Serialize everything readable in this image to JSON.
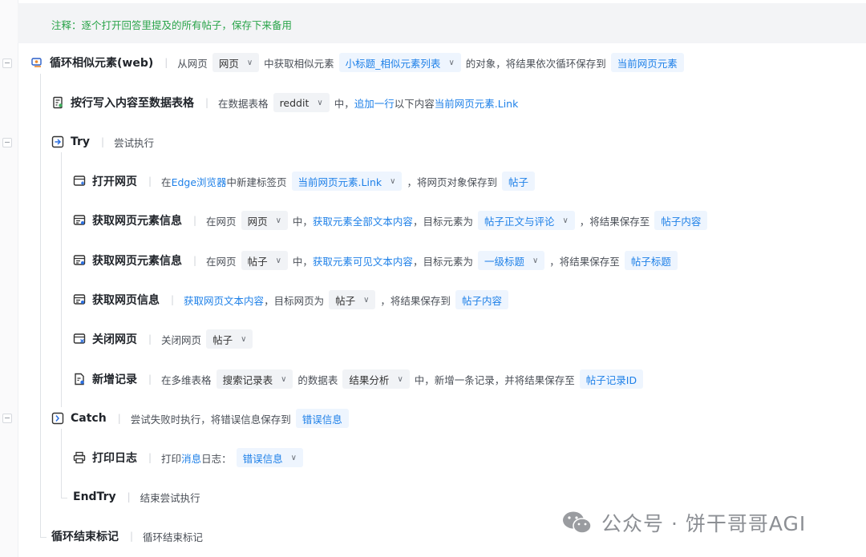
{
  "note": "注释：逐个打开回答里提及的所有帖子，保存下来备用",
  "loop": {
    "title": "循环相似元素(web)",
    "t1": "从网页",
    "chip1": "网页",
    "t2": "中获取相似元素",
    "chip2": "小标题_相似元素列表",
    "t3": "的对象，将结果依次循环保存到",
    "var": "当前网页元素"
  },
  "write": {
    "title": "按行写入内容至数据表格",
    "t1": "在数据表格",
    "chip1": "reddit",
    "t2": "中，",
    "lk1": "追加一行",
    "t3": "以下内容",
    "lk2": "当前网页元素.Link"
  },
  "try": {
    "title": "Try",
    "desc": "尝试执行"
  },
  "open": {
    "title": "打开网页",
    "t1": "在",
    "lk1": "Edge浏览器",
    "t2": "中新建标签页",
    "chip1": "当前网页元素.Link",
    "t3": "，将网页对象保存到",
    "var": "帖子"
  },
  "get1": {
    "title": "获取网页元素信息",
    "t1": "在网页",
    "chip1": "网页",
    "t2": "中，",
    "lk1": "获取元素全部文本内容",
    "t3": "，目标元素为",
    "chip2": "帖子正文与评论",
    "t4": "，将结果保存至",
    "var": "帖子内容"
  },
  "get2": {
    "title": "获取网页元素信息",
    "t1": "在网页",
    "chip1": "帖子",
    "t2": "中，",
    "lk1": "获取元素可见文本内容",
    "t3": "，目标元素为",
    "chip2": "一级标题",
    "t4": "，将结果保存至",
    "var": "帖子标题"
  },
  "getpage": {
    "title": "获取网页信息",
    "lk1": "获取网页文本内容",
    "t1": "，目标网页为",
    "chip1": "帖子",
    "t2": "，将结果保存到",
    "var": "帖子内容"
  },
  "close": {
    "title": "关闭网页",
    "t1": "关闭网页",
    "chip1": "帖子"
  },
  "add": {
    "title": "新增记录",
    "t1": "在多维表格",
    "chip1": "搜索记录表",
    "t2": "的数据表",
    "chip2": "结果分析",
    "t3": "中，新增一条记录，并将结果保存至",
    "var": "帖子记录ID"
  },
  "catch": {
    "title": "Catch",
    "t1": "尝试失败时执行，将错误信息保存到",
    "var": "错误信息"
  },
  "log": {
    "title": "打印日志",
    "t1": "打印",
    "lk1": "消息",
    "t2": "日志：",
    "chip1": "错误信息"
  },
  "endtry": {
    "title": "EndTry",
    "desc": "结束尝试执行"
  },
  "endloop": {
    "title": "循环结束标记",
    "desc": "循环结束标记"
  },
  "watermark": "公众号 · 饼干哥哥AGI",
  "colors": {
    "accent": "#1e80e8",
    "note": "#2aa44a",
    "title": "#1f2329"
  },
  "icons": [
    "loop-icon",
    "table-write-icon",
    "try-icon",
    "open-page-icon",
    "element-info-icon",
    "page-info-icon",
    "close-page-icon",
    "add-record-icon",
    "catch-icon",
    "print-icon",
    "wechat-icon"
  ]
}
